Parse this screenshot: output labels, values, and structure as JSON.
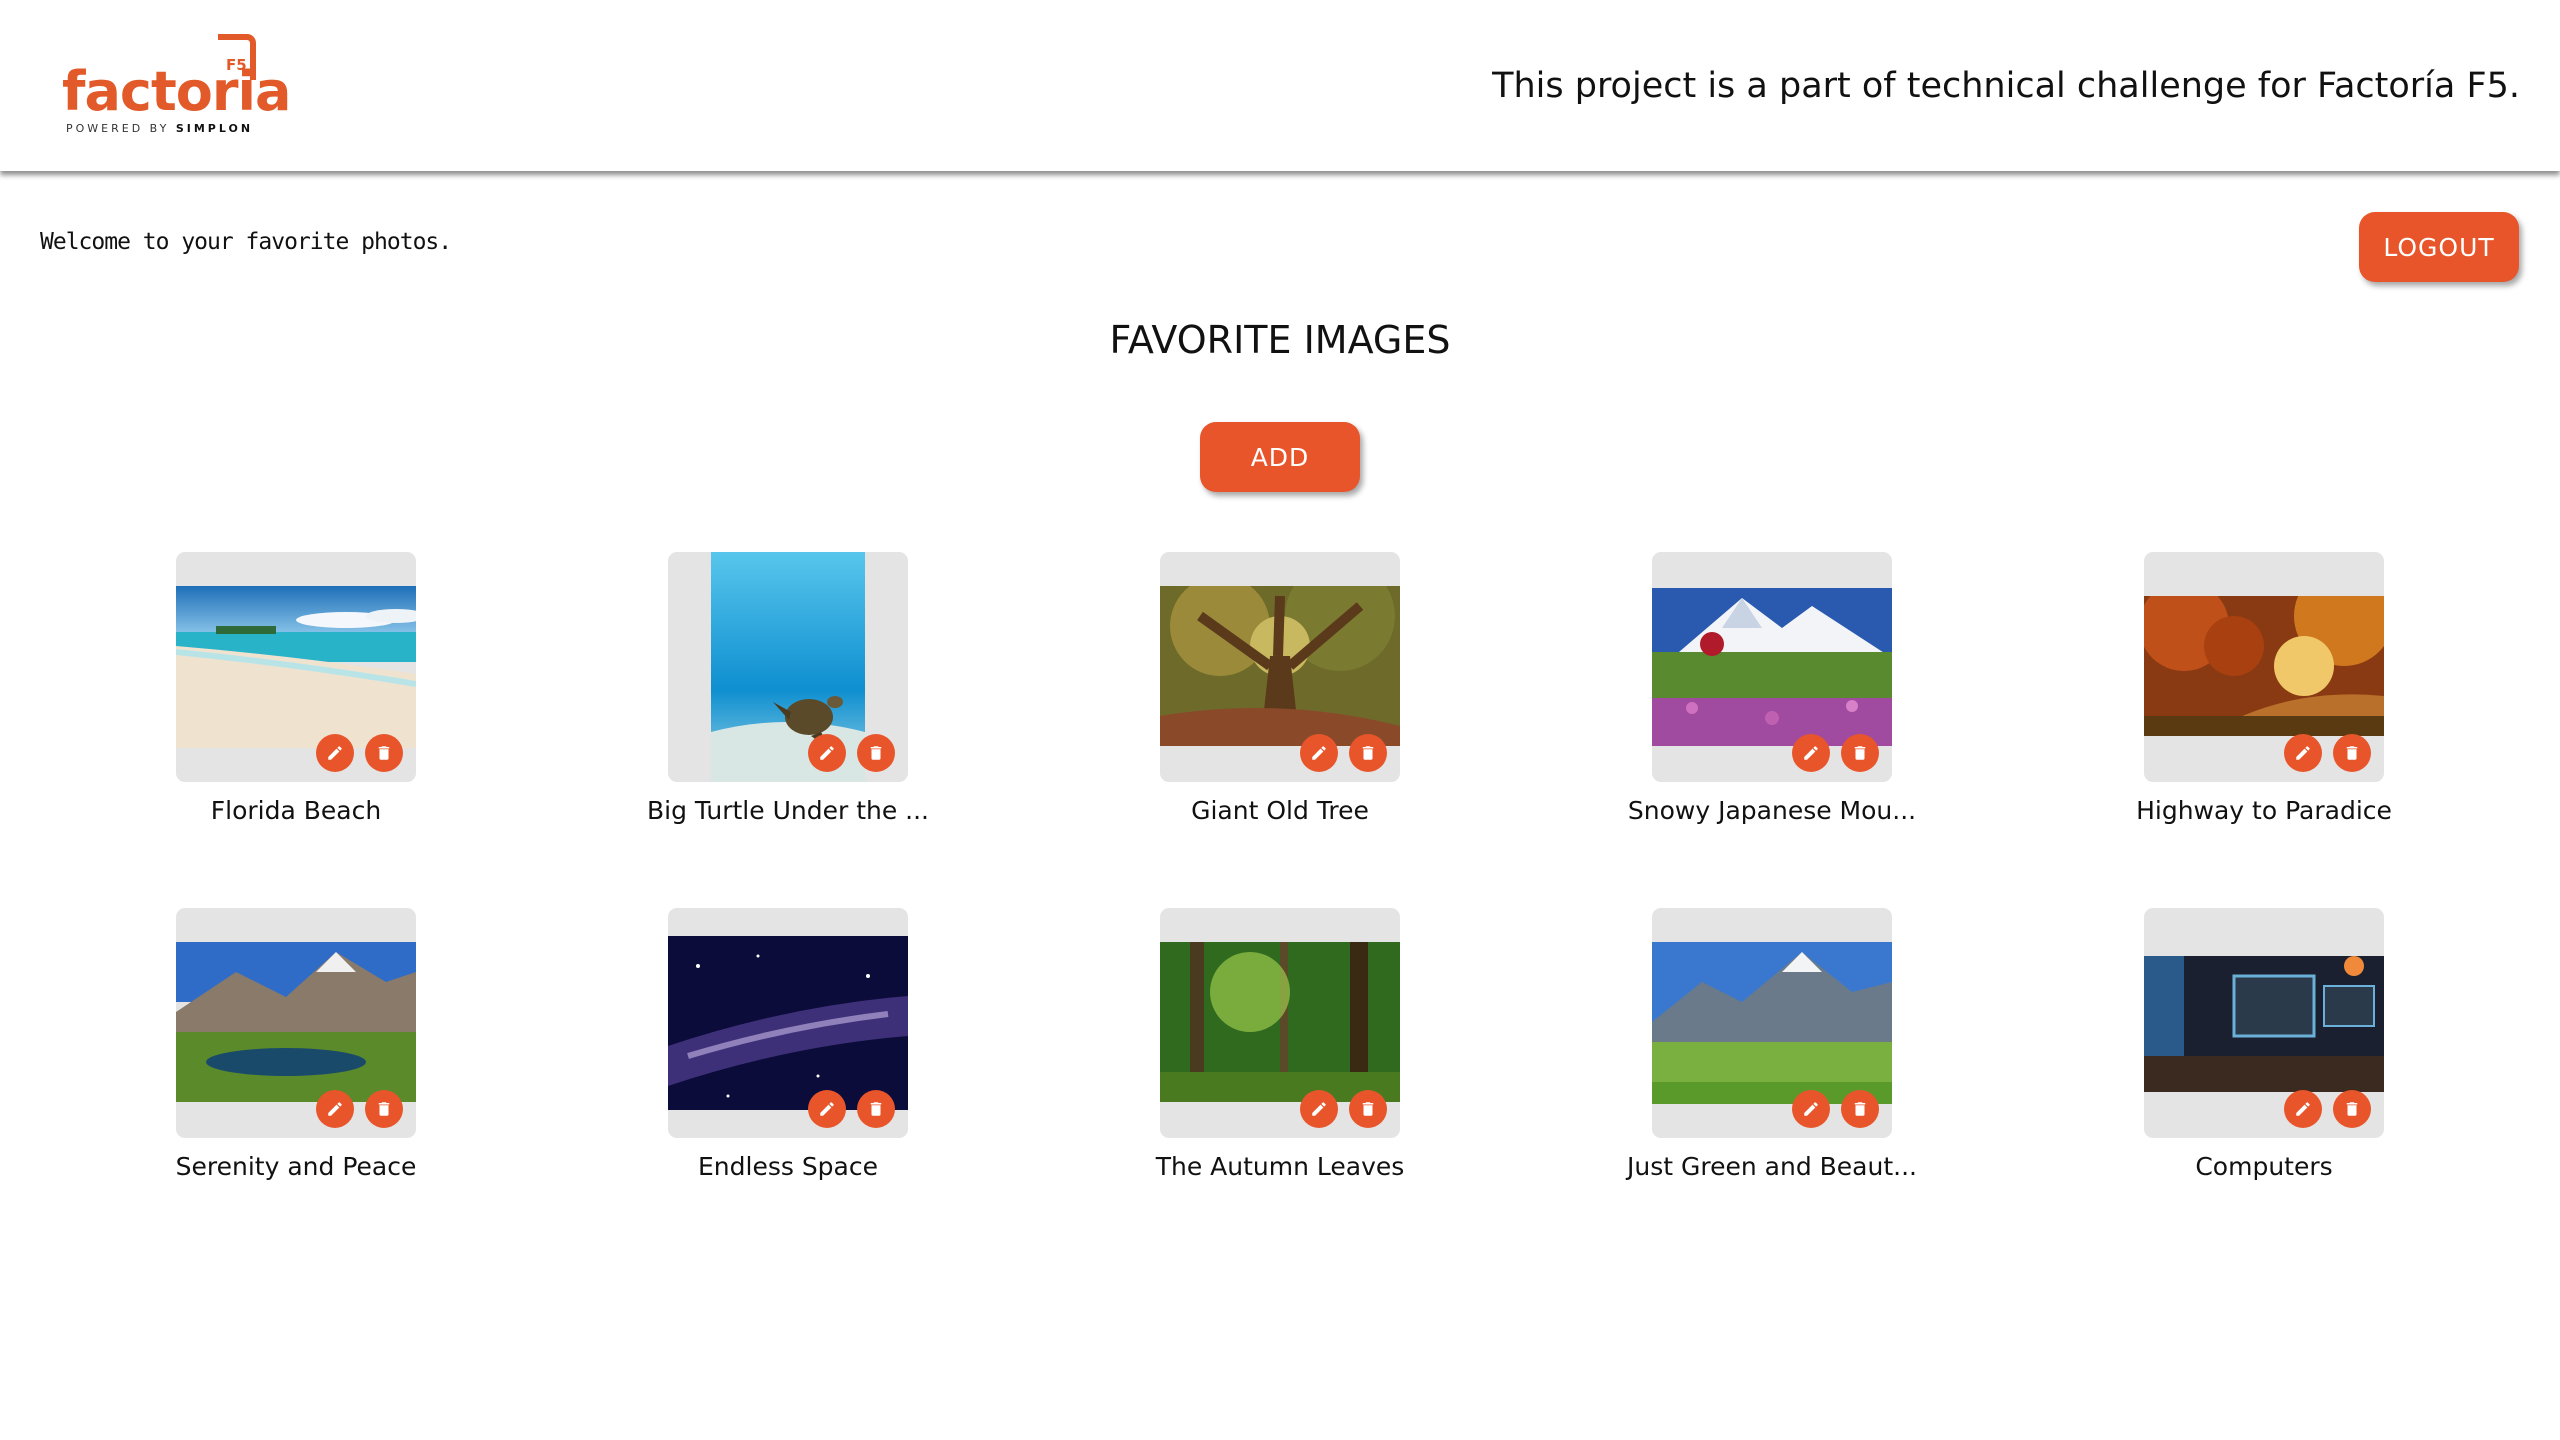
{
  "header": {
    "logo_word": "factoria",
    "logo_badge": "F5",
    "logo_powered": "POWERED BY",
    "logo_powered_brand": "SIMPLON",
    "tagline": "This project is a part of technical challenge for Factoría F5."
  },
  "welcome_text": "Welcome to your favorite photos.",
  "logout_label": "LOGOUT",
  "page_title": "FAVORITE IMAGES",
  "add_label": "ADD",
  "colors": {
    "accent": "#e8552a",
    "card_bg": "#e4e4e4"
  },
  "cards": [
    {
      "title": "Florida Beach",
      "image": "beach"
    },
    {
      "title": "Big Turtle Under the ...",
      "image": "turtle"
    },
    {
      "title": "Giant Old Tree",
      "image": "tree"
    },
    {
      "title": "Snowy Japanese Mou...",
      "image": "snowy-mountain"
    },
    {
      "title": "Highway to Paradice",
      "image": "autumn-road"
    },
    {
      "title": "Serenity and Peace",
      "image": "mountain-lake"
    },
    {
      "title": "Endless Space",
      "image": "milky-way"
    },
    {
      "title": "The Autumn Leaves",
      "image": "green-forest"
    },
    {
      "title": "Just Green and Beaut...",
      "image": "green-valley"
    },
    {
      "title": "Computers",
      "image": "computer-desk"
    }
  ],
  "icons": {
    "edit": "pencil-icon",
    "delete": "trash-icon"
  }
}
